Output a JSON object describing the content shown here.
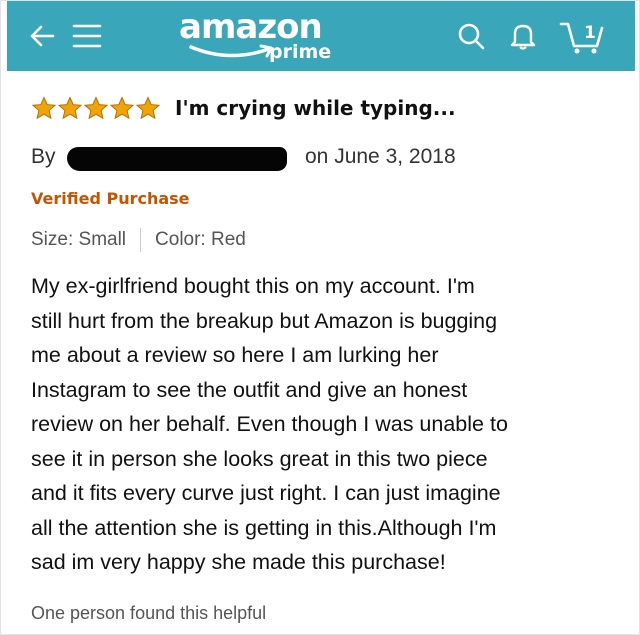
{
  "header": {
    "logo_text": "amazon",
    "logo_sub": "prime",
    "cart_count": "1",
    "brand_color": "#3aa6b9",
    "icons": [
      "back-arrow-icon",
      "menu-icon",
      "search-icon",
      "bell-icon",
      "cart-icon"
    ]
  },
  "review": {
    "rating": 5,
    "rating_max": 5,
    "star_color": "#f0a40a",
    "title": "I'm crying while typing...",
    "by_prefix": "By",
    "date": "on June 3, 2018",
    "verified": "Verified Purchase",
    "size": "Size: Small",
    "color": "Color: Red",
    "body": "My ex-girlfriend bought this on my account. I'm\nstill hurt from the breakup but Amazon is bugging\nme about a review so here I am lurking her\nInstagram to see the outfit and give an honest\nreview on her behalf. Even though I was unable to\nsee it in person she looks great in this two piece\nand it fits every curve just right. I can just imagine\nall the attention she is getting in this.Although I'm\nsad im very happy she made this purchase!",
    "helpful": "One person found this helpful"
  }
}
